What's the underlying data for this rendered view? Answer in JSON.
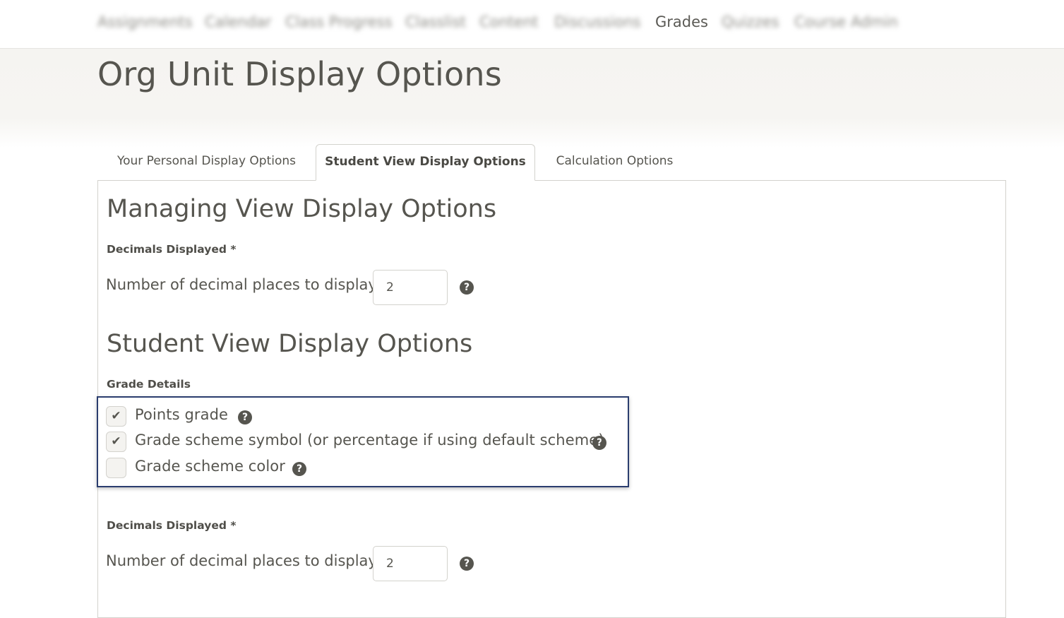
{
  "nav": {
    "items": [
      {
        "label": "Assignments",
        "blurred": true
      },
      {
        "label": "Calendar",
        "blurred": true
      },
      {
        "label": "Class Progress",
        "blurred": true
      },
      {
        "label": "Classlist",
        "blurred": true
      },
      {
        "label": "Content",
        "blurred": true
      },
      {
        "label": "Discussions",
        "blurred": true
      },
      {
        "label": "Grades",
        "blurred": false
      },
      {
        "label": "Quizzes",
        "blurred": true
      },
      {
        "label": "Course Admin",
        "blurred": true
      }
    ]
  },
  "page": {
    "title": "Org Unit Display Options"
  },
  "tabs": [
    {
      "label": "Your Personal Display Options",
      "active": false
    },
    {
      "label": "Student View Display Options",
      "active": true
    },
    {
      "label": "Calculation Options",
      "active": false
    }
  ],
  "managing": {
    "heading": "Managing View Display Options",
    "decimals_label": "Decimals Displayed *",
    "decimals_inline": "Number of decimal places to display",
    "decimals_value": "2"
  },
  "student": {
    "heading": "Student View Display Options",
    "grade_details_label": "Grade Details",
    "options": [
      {
        "label": "Points grade",
        "checked": true
      },
      {
        "label": "Grade scheme symbol (or percentage if using default scheme)",
        "checked": true
      },
      {
        "label": "Grade scheme color",
        "checked": false
      }
    ],
    "decimals_label": "Decimals Displayed *",
    "decimals_inline": "Number of decimal places to display",
    "decimals_value": "2"
  },
  "icons": {
    "help": "help-icon",
    "check": "check-icon"
  },
  "colors": {
    "highlight_border": "#2a3d6e",
    "text": "#56554f",
    "header_band": "#f5f4f1"
  }
}
